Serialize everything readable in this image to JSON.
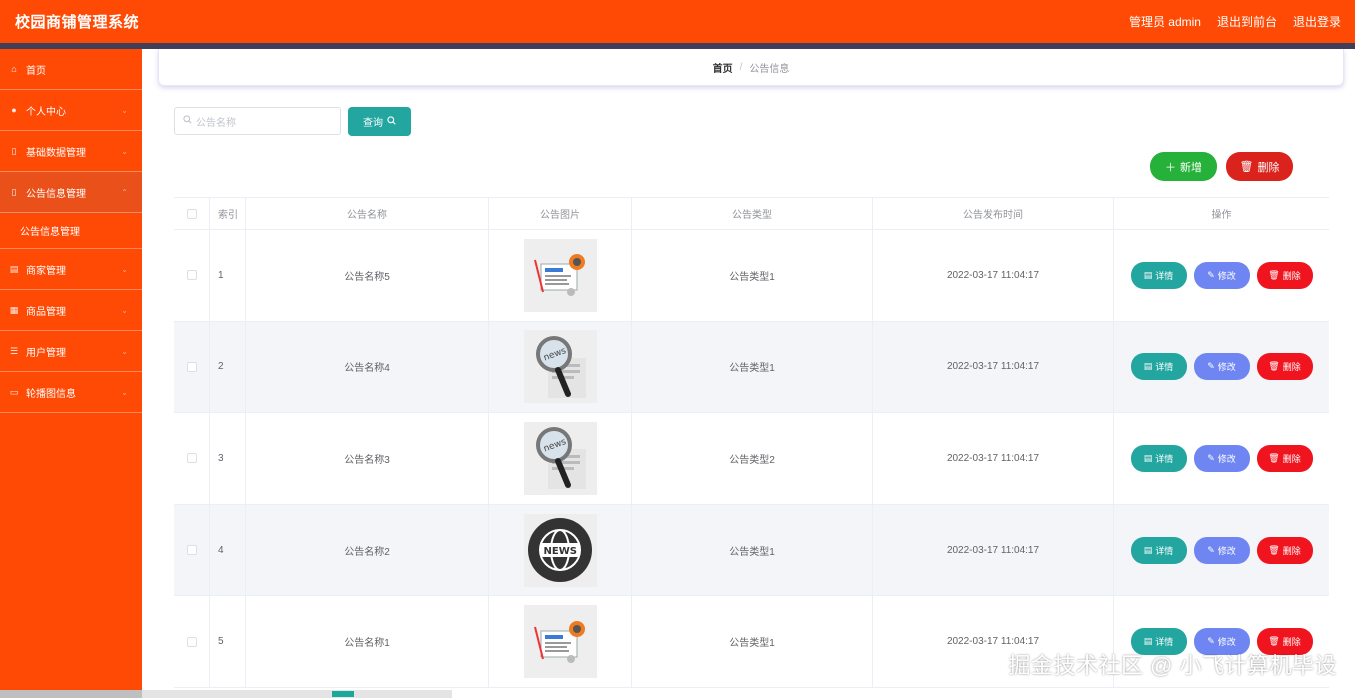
{
  "header": {
    "title": "校园商铺管理系统",
    "admin_label": "管理员 admin",
    "to_frontend": "退出到前台",
    "logout": "退出登录"
  },
  "sidebar": {
    "items": [
      {
        "label": "首页",
        "icon": "home-icon"
      },
      {
        "label": "个人中心",
        "icon": "user-icon"
      },
      {
        "label": "基础数据管理",
        "icon": "database-icon"
      },
      {
        "label": "公告信息管理",
        "icon": "notice-icon"
      },
      {
        "label": "商家管理",
        "icon": "store-icon"
      },
      {
        "label": "商品管理",
        "icon": "goods-icon"
      },
      {
        "label": "用户管理",
        "icon": "users-icon"
      },
      {
        "label": "轮播图信息",
        "icon": "image-icon"
      }
    ],
    "submenu": {
      "label": "公告信息管理"
    }
  },
  "breadcrumb": {
    "home": "首页",
    "sep": "/",
    "current": "公告信息"
  },
  "search": {
    "placeholder": "公告名称",
    "button": "查询"
  },
  "actions": {
    "add": "新增",
    "delete": "删除"
  },
  "table": {
    "headers": {
      "index": "索引",
      "name": "公告名称",
      "image": "公告图片",
      "type": "公告类型",
      "time": "公告发布时间",
      "ops": "操作"
    },
    "rows": [
      {
        "index": "1",
        "name": "公告名称5",
        "image": "news-paper-icon",
        "type": "公告类型1",
        "time": "2022-03-17 11:04:17"
      },
      {
        "index": "2",
        "name": "公告名称4",
        "image": "magnifier-news-icon",
        "type": "公告类型1",
        "time": "2022-03-17 11:04:17"
      },
      {
        "index": "3",
        "name": "公告名称3",
        "image": "magnifier-news-icon",
        "type": "公告类型2",
        "time": "2022-03-17 11:04:17"
      },
      {
        "index": "4",
        "name": "公告名称2",
        "image": "globe-news-icon",
        "type": "公告类型1",
        "time": "2022-03-17 11:04:17"
      },
      {
        "index": "5",
        "name": "公告名称1",
        "image": "news-paper-icon",
        "type": "公告类型1",
        "time": "2022-03-17 11:04:17"
      }
    ],
    "op_labels": {
      "detail": "详情",
      "edit": "修改",
      "delete": "删除"
    }
  },
  "watermark": "掘金技术社区 @ 小飞计算机毕设",
  "colors": {
    "brand": "#ff4a05",
    "teal": "#23a5a0",
    "green": "#26b23a",
    "red": "#d9231c",
    "purple": "#6f86f2"
  }
}
